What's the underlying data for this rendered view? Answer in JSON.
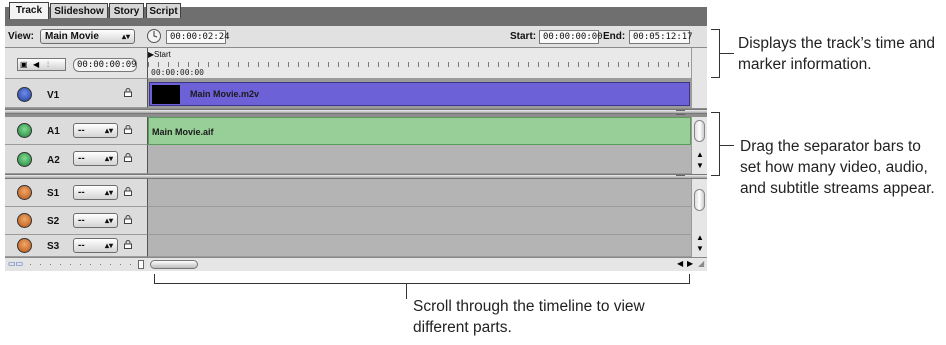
{
  "tabs": [
    {
      "label": "Track",
      "active": true
    },
    {
      "label": "Slideshow",
      "active": false
    },
    {
      "label": "Story",
      "active": false
    },
    {
      "label": "Script",
      "active": false
    }
  ],
  "viewbar": {
    "view_label": "View:",
    "view_value": "Main Movie",
    "playhead_time": "00:00:02:24",
    "start_label": "Start:",
    "start_value": "00:00:00:00",
    "end_label": "End:",
    "end_value": "00:05:12:17"
  },
  "ruler": {
    "timecode": "00:00:00:09",
    "marker_label": "Start",
    "ruler_time": "00:00:00:00"
  },
  "tracks": {
    "video": {
      "name": "V1",
      "clip": "Main Movie.m2v",
      "clip_color": "#6d61d8"
    },
    "audio": [
      {
        "name": "A1",
        "stream": "--",
        "clip": "Main Movie.aif",
        "clip_color": "#98cf98"
      },
      {
        "name": "A2",
        "stream": "--",
        "clip": ""
      }
    ],
    "subtitle": [
      {
        "name": "S1",
        "stream": "--"
      },
      {
        "name": "S2",
        "stream": "--"
      },
      {
        "name": "S3",
        "stream": "--"
      }
    ]
  },
  "colors": {
    "video_icon": "#2a4db8",
    "audio_icon": "#2e9c4c",
    "subtitle_icon": "#d0742a"
  },
  "callouts": {
    "time_info": "Displays the track’s time and marker information.",
    "separator": "Drag the separator bars to set how many video, audio, and subtitle streams appear.",
    "scroll": "Scroll through the timeline to view different parts."
  }
}
